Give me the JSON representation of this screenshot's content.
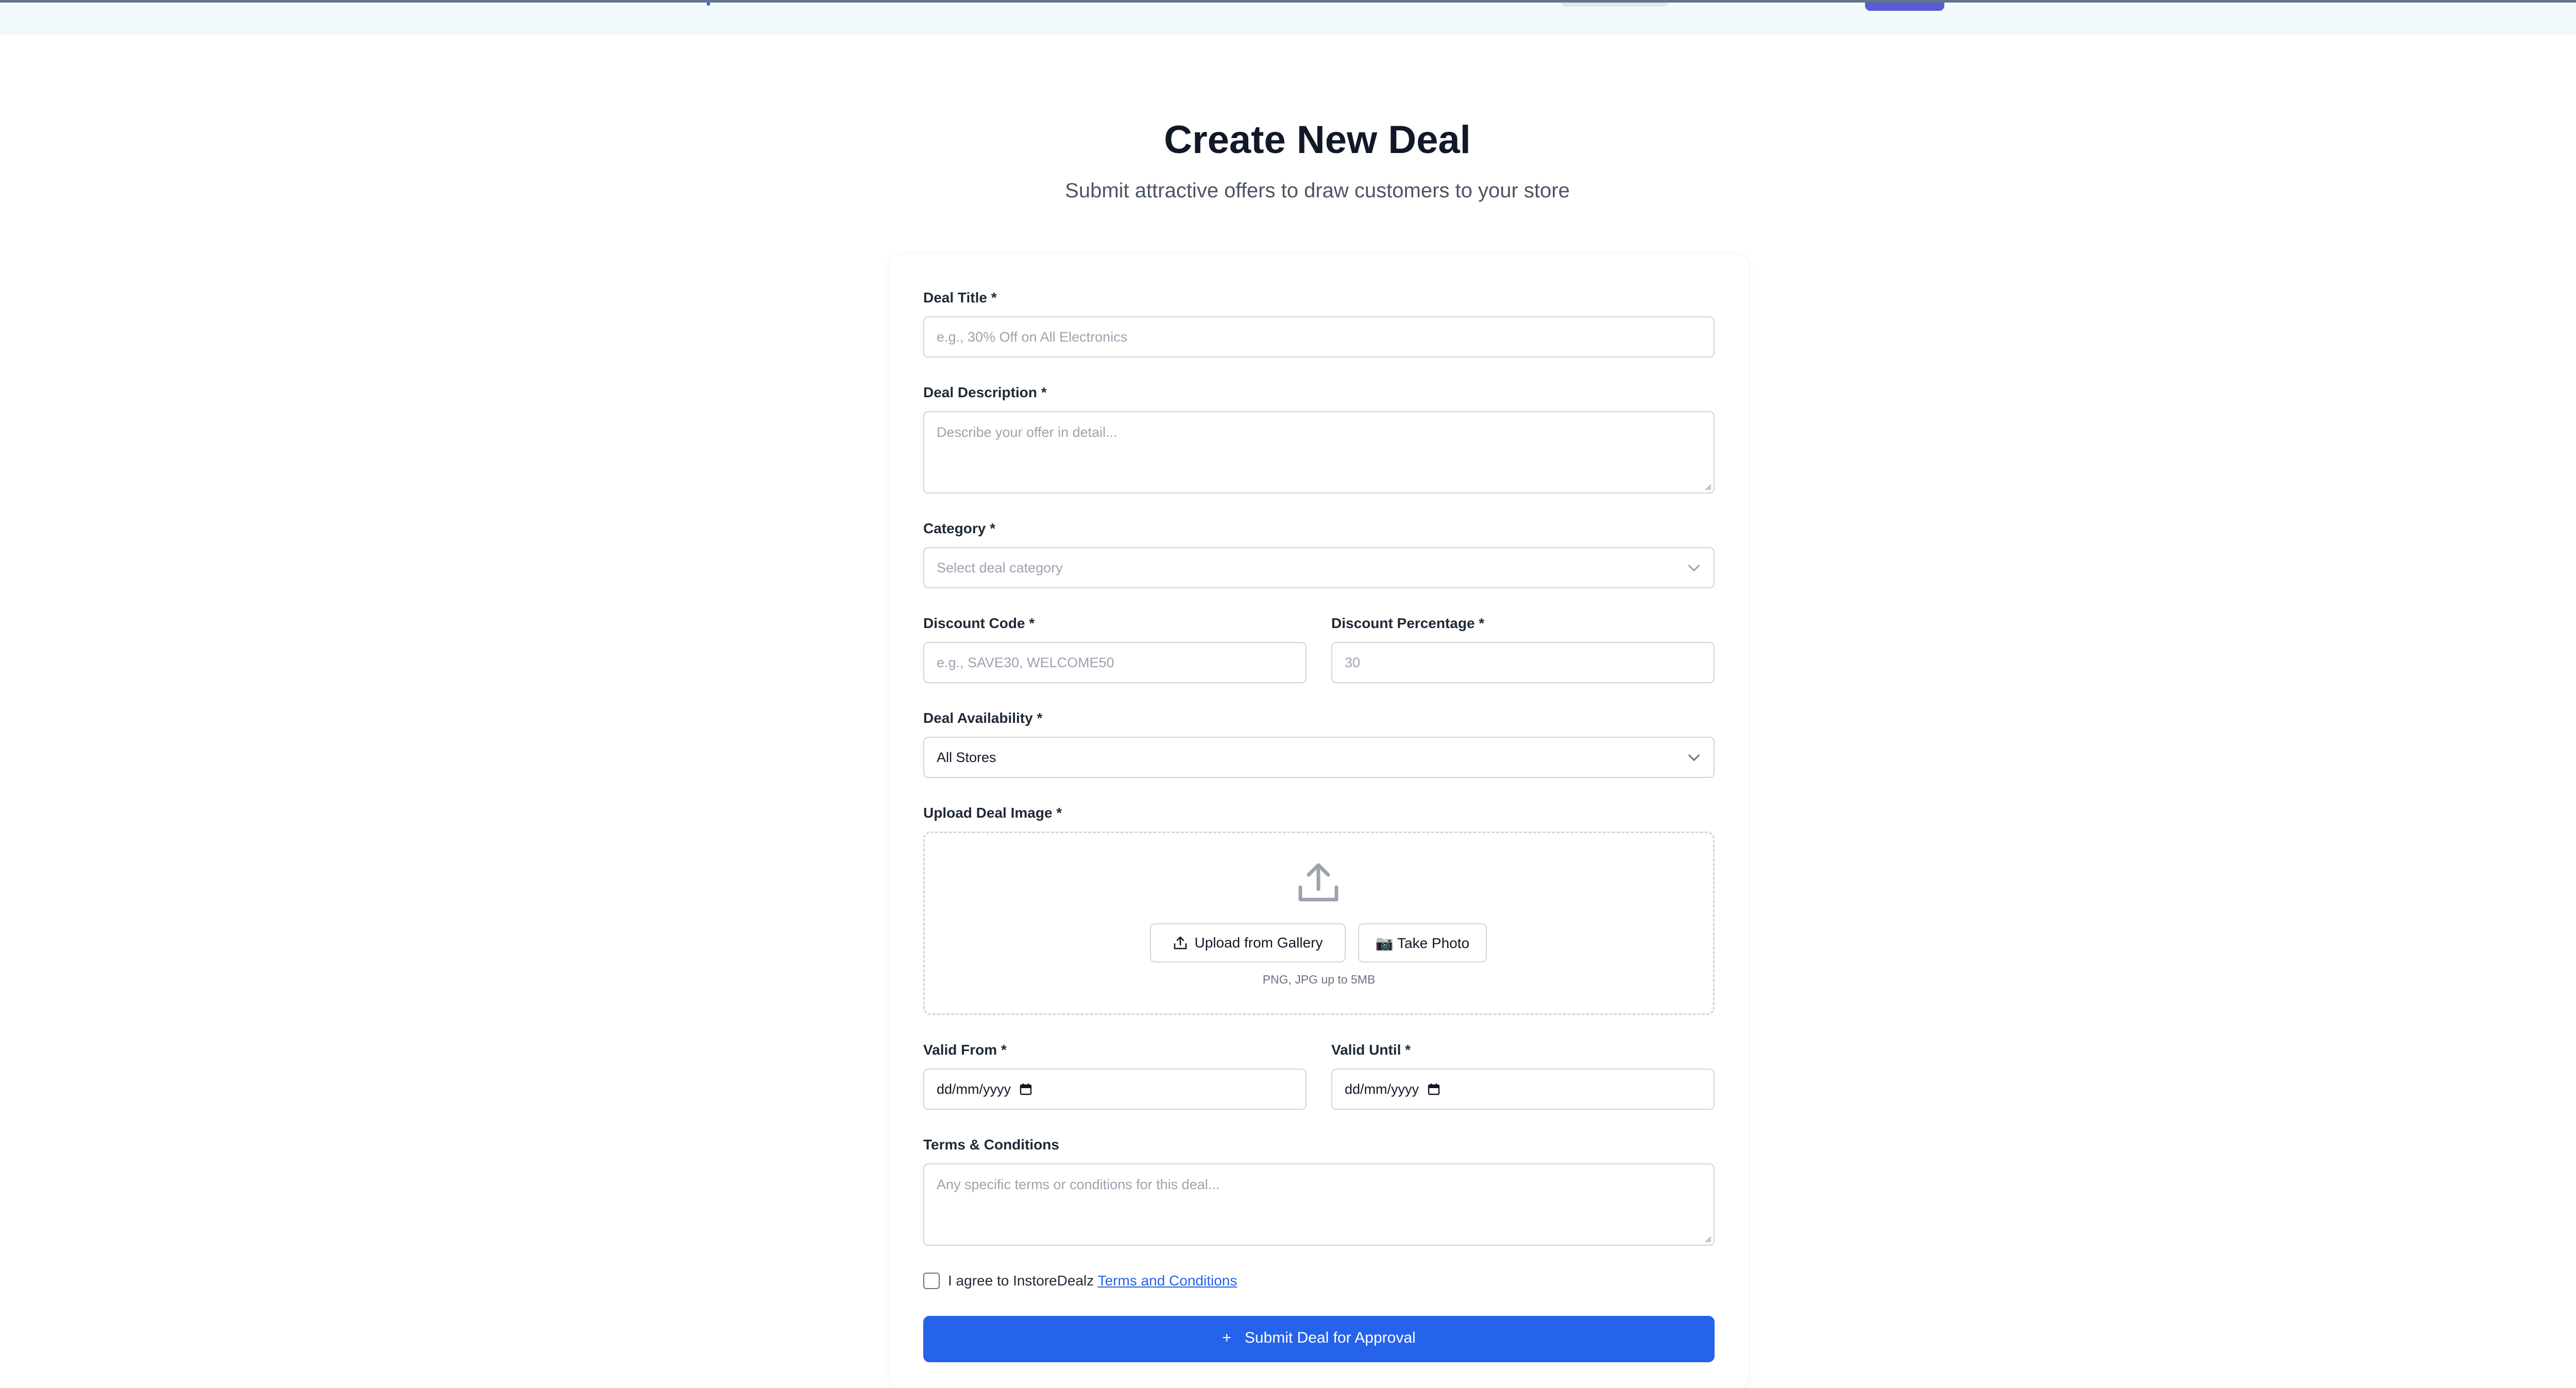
{
  "header": {
    "accent_color": "#5b5bd6"
  },
  "page": {
    "title": "Create New Deal",
    "subtitle": "Submit attractive offers to draw customers to your store"
  },
  "form": {
    "deal_title": {
      "label": "Deal Title *",
      "placeholder": "e.g., 30% Off on All Electronics"
    },
    "deal_description": {
      "label": "Deal Description *",
      "placeholder": "Describe your offer in detail..."
    },
    "category": {
      "label": "Category *",
      "placeholder": "Select deal category"
    },
    "discount_code": {
      "label": "Discount Code *",
      "placeholder": "e.g., SAVE30, WELCOME50"
    },
    "discount_percentage": {
      "label": "Discount Percentage *",
      "placeholder": "30"
    },
    "deal_availability": {
      "label": "Deal Availability *",
      "value": "All Stores"
    },
    "upload_image": {
      "label": "Upload Deal Image *",
      "gallery_button": "Upload from Gallery",
      "camera_button": "📷 Take Photo",
      "hint": "PNG, JPG up to 5MB"
    },
    "valid_from": {
      "label": "Valid From *",
      "value": "dd/mm/yyyy"
    },
    "valid_until": {
      "label": "Valid Until *",
      "value": "dd/mm/yyyy"
    },
    "terms": {
      "label": "Terms & Conditions",
      "placeholder": "Any specific terms or conditions for this deal..."
    },
    "agreement": {
      "text": "I agree to InstoreDealz",
      "link": "Terms and Conditions",
      "checked": false
    },
    "submit": {
      "icon": "+",
      "label": "Submit Deal for Approval",
      "color": "#2563eb"
    }
  }
}
